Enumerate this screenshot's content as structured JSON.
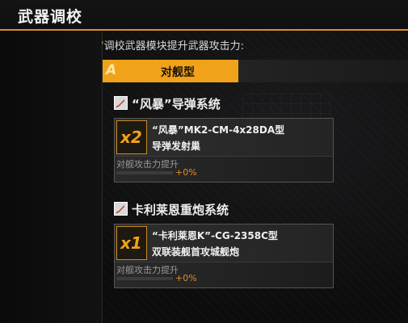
{
  "header": {
    "title": "武器调校"
  },
  "description": {
    "mark": "'",
    "text": "调校武器模块提升武器攻击力:"
  },
  "tabs": [
    {
      "letter": "A",
      "label": "对舰型",
      "active": true
    }
  ],
  "sections": [
    {
      "title": "“风暴”导弹系统",
      "card": {
        "quantity": "x2",
        "name": "“风暴”MK2-CM-4x28DA型",
        "subtitle": "导弹发射巢",
        "stat_label": "对舰攻击力提升",
        "stat_value": "+0%",
        "stat_progress": 0
      }
    },
    {
      "title": "卡利莱恩重炮系统",
      "card": {
        "quantity": "x1",
        "name": "“卡利莱恩K”-CG-2358C型",
        "subtitle": "双联装舰首攻城舰炮",
        "stat_label": "对舰攻击力提升",
        "stat_value": "+0%",
        "stat_progress": 0
      }
    }
  ],
  "colors": {
    "accent": "#f0a21a",
    "header_line": "#e28c2a"
  }
}
